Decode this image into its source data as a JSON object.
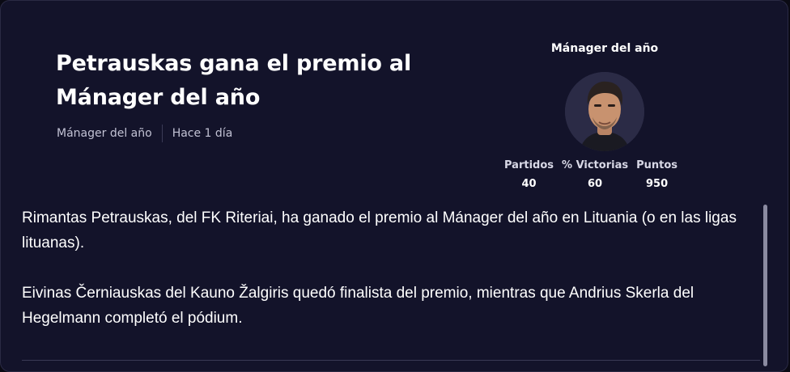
{
  "article": {
    "title": "Petrauskas gana el premio al Mánager del año",
    "category": "Mánager del año",
    "time": "Hace 1 día",
    "paragraphs": [
      "Rimantas Petrauskas, del FK Riteriai, ha ganado el premio al Mánager del año en Lituania (o en las ligas lituanas).",
      "Eivinas Černiauskas del Kauno Žalgiris quedó finalista del premio, mientras que Andrius Skerla del Hegelmann completó el pódium."
    ]
  },
  "award": {
    "title": "Mánager del año",
    "stats": [
      {
        "label": "Partidos",
        "value": "40"
      },
      {
        "label": "% Victorias",
        "value": "60"
      },
      {
        "label": "Puntos",
        "value": "950"
      }
    ]
  },
  "colors": {
    "background": "#13132a",
    "text": "#ffffff",
    "muted": "#c2c2d4"
  }
}
